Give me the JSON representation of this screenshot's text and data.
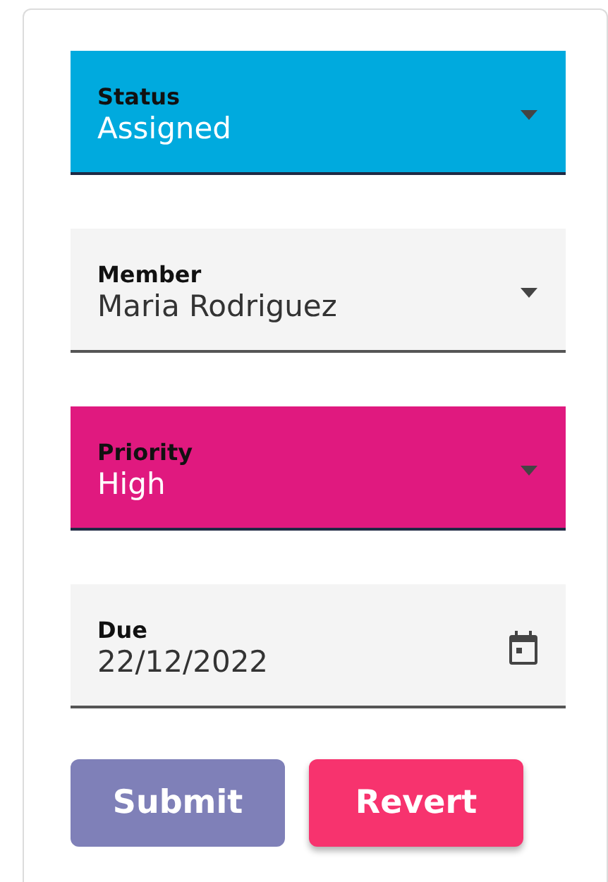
{
  "fields": [
    {
      "kind": "select",
      "label": "Status",
      "value": "Assigned",
      "color": "#00aade"
    },
    {
      "kind": "select",
      "label": "Member",
      "value": "Maria Rodriguez"
    },
    {
      "kind": "select",
      "label": "Priority",
      "value": "High",
      "color": "#e0197f"
    },
    {
      "kind": "date",
      "label": "Due",
      "value": "22/12/2022"
    }
  ],
  "buttons": [
    {
      "label": "Submit",
      "disabled": true,
      "color": "#7f80b8"
    },
    {
      "label": "Revert",
      "disabled": false,
      "color": "#f7336e"
    }
  ]
}
